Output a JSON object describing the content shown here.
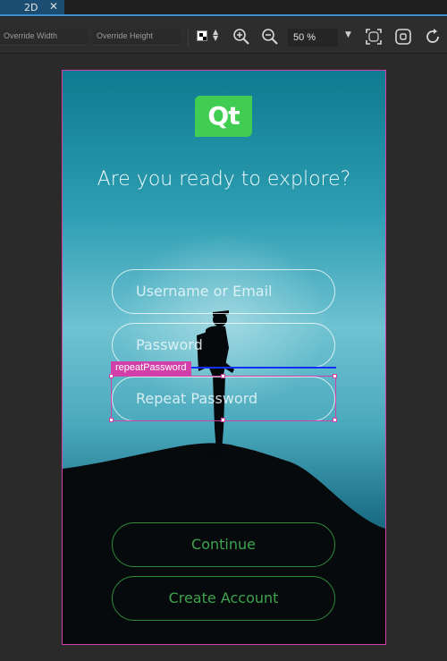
{
  "editor": {
    "tab_label": "2D",
    "override_width_label": "Override Width",
    "override_height_label": "Override Height",
    "zoom_value": "50 %"
  },
  "app": {
    "logo_text": "Qt",
    "headline": "Are you ready to explore?",
    "username_placeholder": "Username or Email",
    "password_placeholder": "Password",
    "repeat_password_placeholder": "Repeat Password",
    "continue_label": "Continue",
    "create_account_label": "Create Account"
  },
  "selection": {
    "component_id": "repeatPassword",
    "highlight_color": "#d23fa8"
  },
  "colors": {
    "qt_green": "#41cd52",
    "button_green": "#3fa34d",
    "accent_blue": "#3b8ecf"
  }
}
